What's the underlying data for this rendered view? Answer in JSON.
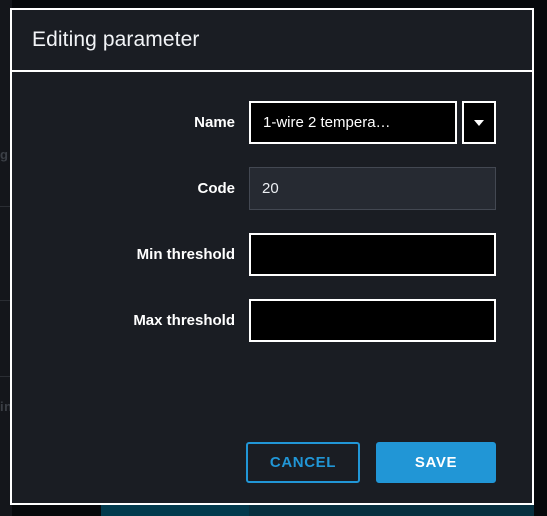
{
  "window": {
    "background_color": "#06080b"
  },
  "dialog": {
    "title": "Editing parameter",
    "border_color": "#ffffff",
    "background_color": "#1a1d23",
    "fields": [
      {
        "label": "Name",
        "type": "select",
        "value": "1-wire 2 tempera…",
        "placeholder": "",
        "disabled": false,
        "arrow_icon": "chevron-down-icon"
      },
      {
        "label": "Code",
        "type": "text",
        "value": "20",
        "placeholder": "",
        "disabled": true
      },
      {
        "label": "Min threshold",
        "type": "text",
        "value": "",
        "placeholder": "",
        "disabled": false
      },
      {
        "label": "Max threshold",
        "type": "text",
        "value": "",
        "placeholder": "",
        "disabled": false
      }
    ],
    "buttons": {
      "cancel_label": "CANCEL",
      "save_label": "SAVE",
      "accent_color": "#2196d6"
    }
  },
  "backdrop": {
    "ghost_text_1": "g",
    "ghost_text_2": "in",
    "blue_bar_color": "#023a4d"
  }
}
